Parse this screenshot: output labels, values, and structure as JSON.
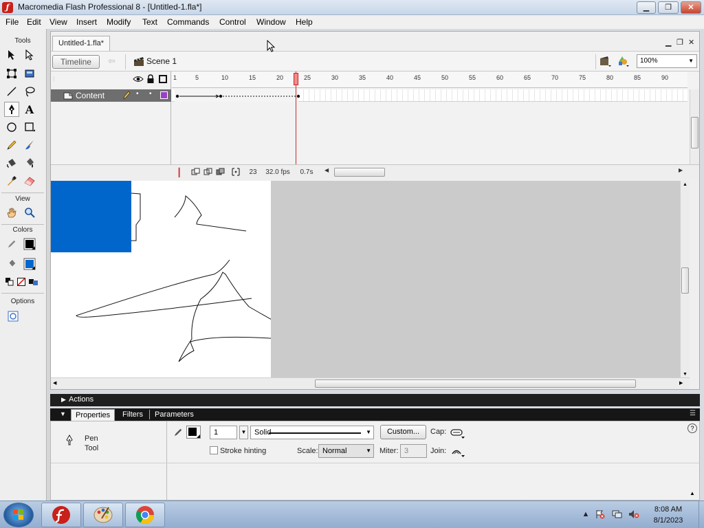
{
  "window": {
    "title": "Macromedia Flash Professional 8 - [Untitled-1.fla*]"
  },
  "menu": [
    "File",
    "Edit",
    "View",
    "Insert",
    "Modify",
    "Text",
    "Commands",
    "Control",
    "Window",
    "Help"
  ],
  "tools_panel": {
    "header": "Tools",
    "view_header": "View",
    "colors_header": "Colors",
    "options_header": "Options",
    "selected_tool": "pen",
    "stroke_color": "#000000",
    "fill_color": "#0066cc"
  },
  "document": {
    "tab": "Untitled-1.fla*",
    "timeline_button": "Timeline",
    "scene": "Scene 1",
    "zoom": "100%"
  },
  "timeline": {
    "layer_name": "Content",
    "ruler_labels": [
      "1",
      "5",
      "10",
      "15",
      "20",
      "25",
      "30",
      "35",
      "40",
      "45",
      "50",
      "55",
      "60",
      "65",
      "70",
      "75",
      "80",
      "85",
      "90"
    ],
    "current_frame": "23",
    "frame_rate": "32.0 fps",
    "elapsed_time": "0.7s"
  },
  "panels": {
    "actions": "Actions",
    "tabs": [
      "Properties",
      "Filters",
      "Parameters"
    ],
    "active_tab": "Properties"
  },
  "properties": {
    "tool_name_line1": "Pen",
    "tool_name_line2": "Tool",
    "stroke_height": "1",
    "stroke_style": "Solid",
    "custom_button": "Custom...",
    "cap_label": "Cap:",
    "stroke_hinting": "Stroke hinting",
    "scale_label": "Scale:",
    "scale_value": "Normal",
    "miter_label": "Miter:",
    "miter_value": "3",
    "join_label": "Join:"
  },
  "taskbar": {
    "time": "8:08 AM",
    "date": "8/1/2023"
  }
}
